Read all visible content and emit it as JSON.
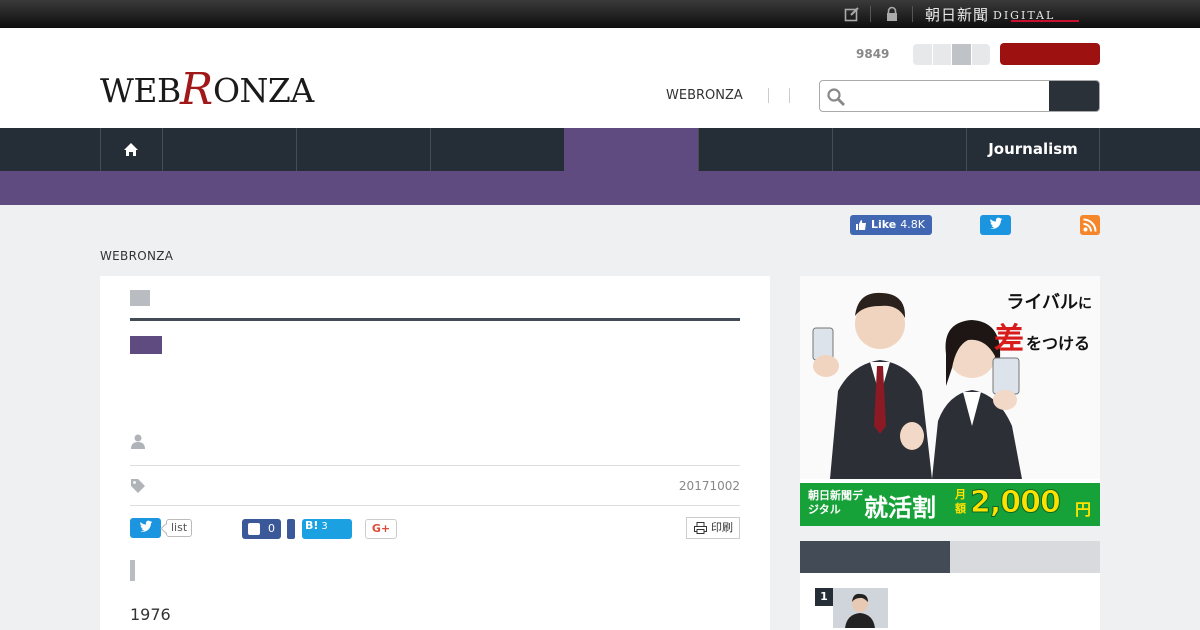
{
  "topbar": {
    "brand": "朝日新聞",
    "brand_suffix": "DIGITAL",
    "icons": [
      "edit-icon",
      "lock-icon"
    ]
  },
  "header": {
    "logo_text": "WEBRONZA",
    "count": "9849",
    "link": "WEBRONZA",
    "search": {
      "placeholder": "",
      "value": ""
    }
  },
  "nav": {
    "items": [
      {
        "label": "",
        "icon": "home-icon"
      },
      {
        "label": ""
      },
      {
        "label": ""
      },
      {
        "label": ""
      },
      {
        "label": "",
        "active": true
      },
      {
        "label": ""
      },
      {
        "label": "Journalism"
      }
    ]
  },
  "social": {
    "fb_like_label": "Like",
    "fb_like_count": "4.8K"
  },
  "breadcrumb": "WEBRONZA",
  "article": {
    "date": "20171002",
    "share": {
      "list_label": "list",
      "fb_count": "0",
      "hatena_label": "B!",
      "hatena_count": "3",
      "gplus_label": "G+",
      "print_label": "印刷"
    },
    "body_first": "1976"
  },
  "ad": {
    "tagline_main": "ライバル",
    "tagline_particle": "に",
    "tagline_big": "差",
    "tagline_rest": "をつける",
    "band_brand": "朝日新聞デジタル",
    "band_title": "就活割",
    "band_unit": "月額",
    "band_price": "2,000",
    "band_currency": "円"
  },
  "ranking": {
    "items": [
      {
        "rank": "1"
      }
    ]
  },
  "colors": {
    "accent_purple": "#5f4b7f",
    "nav_dark": "#252d36",
    "brand_red": "#9e1111",
    "logo_r_red": "#a01818"
  }
}
